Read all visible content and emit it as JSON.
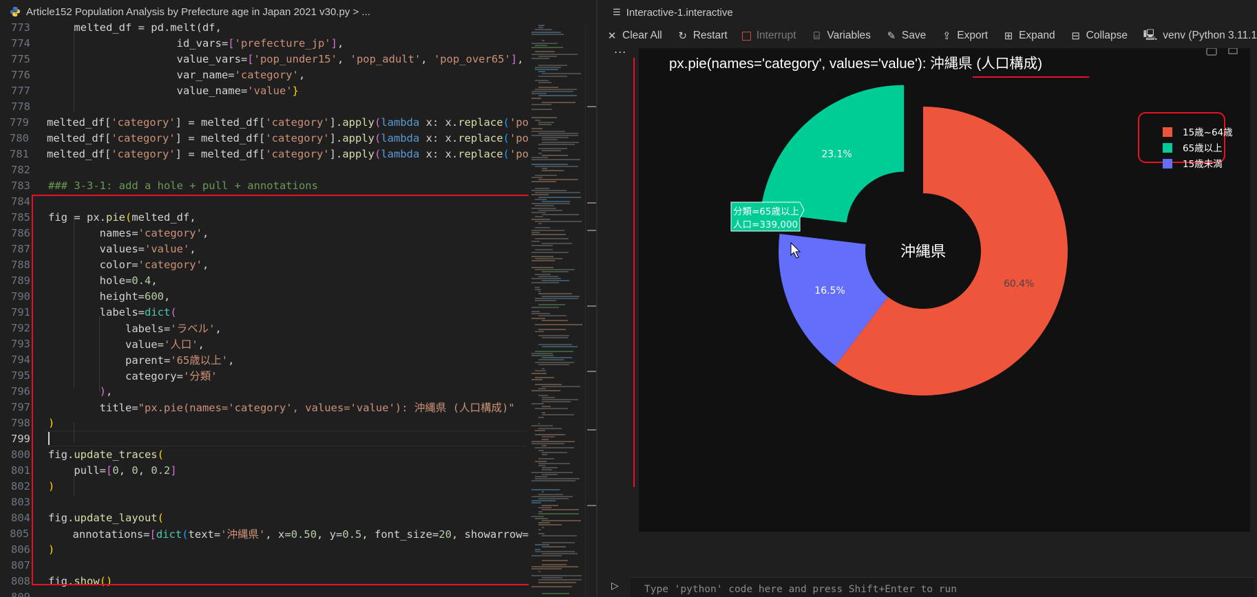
{
  "editor": {
    "breadcrumb": "Article152 Population Analysis by Prefecture age in Japan 2021 v30.py > ...",
    "lines": [
      {
        "no": "773",
        "tokens": [
          [
            "v",
            "    melted_df = pd.melt(df,"
          ]
        ]
      },
      {
        "no": "774",
        "tokens": [
          [
            "v",
            "                    id_vars="
          ],
          [
            "p2",
            "["
          ],
          [
            "s",
            "'prefecture_jp'"
          ],
          [
            "p2",
            "]"
          ],
          [
            "v",
            ","
          ]
        ]
      },
      {
        "no": "775",
        "tokens": [
          [
            "v",
            "                    value_vars="
          ],
          [
            "p2",
            "["
          ],
          [
            "s",
            "'pop_under15'"
          ],
          [
            "v",
            ", "
          ],
          [
            "s",
            "'pop_adult'"
          ],
          [
            "v",
            ", "
          ],
          [
            "s",
            "'pop_over65'"
          ],
          [
            "p2",
            "]"
          ],
          [
            "v",
            ","
          ]
        ]
      },
      {
        "no": "776",
        "tokens": [
          [
            "v",
            "                    var_name="
          ],
          [
            "s",
            "'category'"
          ],
          [
            "v",
            ","
          ]
        ]
      },
      {
        "no": "777",
        "tokens": [
          [
            "v",
            "                    value_name="
          ],
          [
            "s",
            "'value'"
          ],
          [
            "p",
            "}"
          ],
          [
            "v",
            ""
          ]
        ]
      },
      {
        "no": "778",
        "tokens": [
          [
            "v",
            ""
          ]
        ]
      },
      {
        "no": "779",
        "tokens": [
          [
            "v",
            "melted_df["
          ],
          [
            "s",
            "'category'"
          ],
          [
            "v",
            "] = melted_df["
          ],
          [
            "s",
            "'category'"
          ],
          [
            "v",
            "]."
          ],
          [
            "f",
            "apply"
          ],
          [
            "p2",
            "("
          ],
          [
            "k",
            "lambda"
          ],
          [
            "v",
            " x: x."
          ],
          [
            "f",
            "replace"
          ],
          [
            "p3",
            "("
          ],
          [
            "s",
            "'po"
          ]
        ]
      },
      {
        "no": "780",
        "tokens": [
          [
            "v",
            "melted_df["
          ],
          [
            "s",
            "'category'"
          ],
          [
            "v",
            "] = melted_df["
          ],
          [
            "s",
            "'category'"
          ],
          [
            "v",
            "]."
          ],
          [
            "f",
            "apply"
          ],
          [
            "p2",
            "("
          ],
          [
            "k",
            "lambda"
          ],
          [
            "v",
            " x: x."
          ],
          [
            "f",
            "replace"
          ],
          [
            "p3",
            "("
          ],
          [
            "s",
            "'po"
          ]
        ]
      },
      {
        "no": "781",
        "tokens": [
          [
            "v",
            "melted_df["
          ],
          [
            "s",
            "'category'"
          ],
          [
            "v",
            "] = melted_df["
          ],
          [
            "s",
            "'category'"
          ],
          [
            "v",
            "]."
          ],
          [
            "f",
            "apply"
          ],
          [
            "p2",
            "("
          ],
          [
            "k",
            "lambda"
          ],
          [
            "v",
            " x: x."
          ],
          [
            "f",
            "replace"
          ],
          [
            "p3",
            "("
          ],
          [
            "s",
            "'po"
          ]
        ]
      },
      {
        "no": "782",
        "tokens": [
          [
            "v",
            ""
          ]
        ]
      },
      {
        "no": "783",
        "tokens": [
          [
            "c",
            "### 3-3-1: add a hole + pull + annotations"
          ]
        ]
      },
      {
        "no": "784",
        "tokens": [
          [
            "v",
            ""
          ]
        ]
      },
      {
        "no": "785",
        "tokens": [
          [
            "v",
            "fig = px."
          ],
          [
            "f",
            "pie"
          ],
          [
            "p",
            "("
          ],
          [
            "v",
            "melted_df,"
          ]
        ]
      },
      {
        "no": "786",
        "tokens": [
          [
            "v",
            "        names="
          ],
          [
            "s",
            "'category'"
          ],
          [
            "v",
            ","
          ]
        ]
      },
      {
        "no": "787",
        "tokens": [
          [
            "v",
            "        values="
          ],
          [
            "s",
            "'value'"
          ],
          [
            "v",
            ","
          ]
        ]
      },
      {
        "no": "788",
        "tokens": [
          [
            "v",
            "        color="
          ],
          [
            "s",
            "'category'"
          ],
          [
            "v",
            ","
          ]
        ]
      },
      {
        "no": "789",
        "tokens": [
          [
            "v",
            "        hole="
          ],
          [
            "n",
            "0.4"
          ],
          [
            "v",
            ","
          ]
        ]
      },
      {
        "no": "790",
        "tokens": [
          [
            "v",
            "        height="
          ],
          [
            "n",
            "600"
          ],
          [
            "v",
            ","
          ]
        ]
      },
      {
        "no": "791",
        "tokens": [
          [
            "v",
            "        labels="
          ],
          [
            "cls",
            "dict"
          ],
          [
            "p2",
            "("
          ]
        ]
      },
      {
        "no": "792",
        "tokens": [
          [
            "v",
            "            labels="
          ],
          [
            "s",
            "'ラベル'"
          ],
          [
            "v",
            ","
          ]
        ]
      },
      {
        "no": "793",
        "tokens": [
          [
            "v",
            "            value="
          ],
          [
            "s",
            "'人口'"
          ],
          [
            "v",
            ","
          ]
        ]
      },
      {
        "no": "794",
        "tokens": [
          [
            "v",
            "            parent="
          ],
          [
            "s",
            "'65歳以上'"
          ],
          [
            "v",
            ","
          ]
        ]
      },
      {
        "no": "795",
        "tokens": [
          [
            "v",
            "            category="
          ],
          [
            "s",
            "'分類'"
          ]
        ]
      },
      {
        "no": "796",
        "tokens": [
          [
            "v",
            "        "
          ],
          [
            "p2",
            ")"
          ],
          [
            "v",
            ","
          ]
        ]
      },
      {
        "no": "797",
        "tokens": [
          [
            "v",
            "        title="
          ],
          [
            "s",
            "\"px.pie(names='category', values='value'): 沖縄県 (人口構成)\""
          ]
        ]
      },
      {
        "no": "798",
        "tokens": [
          [
            "p",
            ")"
          ]
        ]
      },
      {
        "no": "799",
        "tokens": [
          [
            "v",
            ""
          ]
        ]
      },
      {
        "no": "800",
        "tokens": [
          [
            "v",
            "fig."
          ],
          [
            "f",
            "update_traces"
          ],
          [
            "p",
            "("
          ]
        ]
      },
      {
        "no": "801",
        "tokens": [
          [
            "v",
            "    pull="
          ],
          [
            "p2",
            "["
          ],
          [
            "n",
            "0"
          ],
          [
            "v",
            ", "
          ],
          [
            "n",
            "0"
          ],
          [
            "v",
            ", "
          ],
          [
            "n",
            "0.2"
          ],
          [
            "p2",
            "]"
          ]
        ]
      },
      {
        "no": "802",
        "tokens": [
          [
            "p",
            ")"
          ]
        ]
      },
      {
        "no": "803",
        "tokens": [
          [
            "v",
            ""
          ]
        ]
      },
      {
        "no": "804",
        "tokens": [
          [
            "v",
            "fig."
          ],
          [
            "f",
            "update_layout"
          ],
          [
            "p",
            "("
          ]
        ]
      },
      {
        "no": "805",
        "tokens": [
          [
            "v",
            "    annotations="
          ],
          [
            "p2",
            "["
          ],
          [
            "cls",
            "dict"
          ],
          [
            "p3",
            "("
          ],
          [
            "v",
            "text="
          ],
          [
            "s",
            "'沖縄県'"
          ],
          [
            "v",
            ", x="
          ],
          [
            "n",
            "0.50"
          ],
          [
            "v",
            ", y="
          ],
          [
            "n",
            "0.5"
          ],
          [
            "v",
            ", font_size="
          ],
          [
            "n",
            "20"
          ],
          [
            "v",
            ", showarrow="
          ]
        ]
      },
      {
        "no": "806",
        "tokens": [
          [
            "p",
            ")"
          ]
        ]
      },
      {
        "no": "807",
        "tokens": [
          [
            "v",
            ""
          ]
        ]
      },
      {
        "no": "808",
        "tokens": [
          [
            "v",
            "fig."
          ],
          [
            "f",
            "show"
          ],
          [
            "p",
            "()"
          ]
        ]
      },
      {
        "no": "809",
        "tokens": [
          [
            "v",
            ""
          ]
        ]
      }
    ]
  },
  "interactive": {
    "tab_title": "Interactive-1.interactive",
    "toolbar": {
      "clear_all": "Clear All",
      "restart": "Restart",
      "interrupt": "Interrupt",
      "variables": "Variables",
      "save": "Save",
      "export": "Export",
      "expand": "Expand",
      "collapse": "Collapse"
    },
    "kernel": "venv (Python 3.11.1",
    "ellipsis": "...",
    "input_placeholder": "Type 'python' code here and press Shift+Enter to run"
  },
  "colors": {
    "annotation_red": "#e81123",
    "plot_bg": "#111111",
    "adult": "#ef553b",
    "over65": "#00cc96",
    "under15": "#636efa"
  },
  "chart_data": {
    "type": "pie",
    "title_prefix": "px.pie(names='category', values='value'): ",
    "title_highlight": "沖縄県 (人口構成)",
    "center_annotation": "沖縄県",
    "hole": 0.4,
    "slices": [
      {
        "label": "15歳~64歳",
        "percent_text": "60.4%",
        "percent": 60.4,
        "color": "#ef553b",
        "pull": 0
      },
      {
        "label": "15歳未満",
        "percent_text": "16.5%",
        "percent": 16.5,
        "color": "#636efa",
        "pull": 0
      },
      {
        "label": "65歳以上",
        "percent_text": "23.1%",
        "percent": 23.1,
        "color": "#00cc96",
        "pull": 0.2
      }
    ],
    "legend": [
      "15歳~64歳",
      "65歳以上",
      "15歳未満"
    ],
    "legend_position": "top-right",
    "hover": {
      "line1": "分類=65歳以上",
      "line2": "人口=339,000"
    }
  }
}
